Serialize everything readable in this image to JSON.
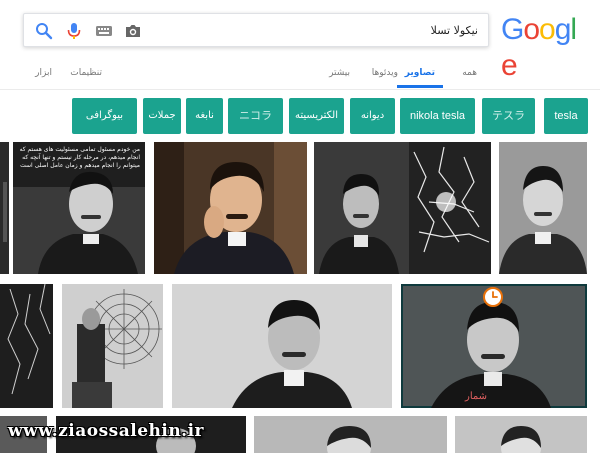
{
  "brand": {
    "logo_letters": [
      "G",
      "o",
      "o",
      "g",
      "l",
      "e"
    ],
    "logo_colors": [
      "#4285F4",
      "#EA4335",
      "#FBBC05",
      "#4285F4",
      "#34A853",
      "#EA4335"
    ]
  },
  "search": {
    "value": "نیکولا تسلا"
  },
  "tabs": {
    "all": "همه",
    "images": "تصاویر",
    "videos": "ویدئوها",
    "more": "بیشتر",
    "settings": "تنظیمات",
    "tools": "ابزار"
  },
  "chips": [
    "tesla",
    "テスラ",
    "nikola tesla",
    "دیوانه",
    "الکتریسیته",
    "ニコラ",
    "نابغه",
    "جملات",
    "بیوگرافی"
  ],
  "results": {
    "quote_overlay": "من خودم مسئول تمامی مسئولیت های هستم که انجام میدهم، در مرحله کار نیستم و تنها آنچه که میتوانم را انجام میدهم و زمان عامل اصلی است",
    "shamar_watermark": "شمار",
    "site_watermark": "www.ziaossalehin.ir"
  },
  "colors": {
    "accent_blue": "#1a73e8",
    "chip_teal": "#1ba38f",
    "mic_blue": "#4285F4",
    "mic_red": "#EA4335"
  }
}
